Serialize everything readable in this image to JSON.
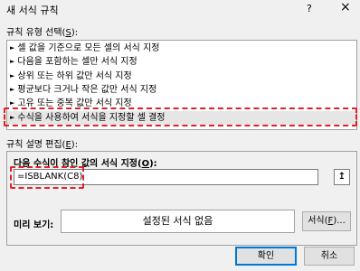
{
  "window": {
    "title": "새 서식 규칙",
    "help": "?",
    "close": "×"
  },
  "rule_type": {
    "label_prefix": "규칙 유형 선택(",
    "label_key": "S",
    "label_suffix": "):",
    "items": [
      "셀 값을 기준으로 모든 셀의 서식 지정",
      "다음을 포함하는 셀만 서식 지정",
      "상위 또는 하위 값만 서식 지정",
      "평균보다 크거나 작은 값만 서식 지정",
      "고유 또는 중복 값만 서식 지정",
      "수식을 사용하여 서식을 지정할 셀 결정"
    ],
    "selected_index": 5
  },
  "rule_desc": {
    "label_prefix": "규칙 설명 편집(",
    "label_key": "E",
    "label_suffix": "):",
    "formula_label_prefix": "다음 수식이 참인 값의 서식 지정(",
    "formula_label_key": "O",
    "formula_label_suffix": "):",
    "formula_value": "=ISBLANK(C8)",
    "collapse_icon": "↥"
  },
  "preview": {
    "label": "미리 보기:",
    "text": "설정된 서식 없음",
    "format_button_prefix": "서식(",
    "format_button_key": "F",
    "format_button_suffix": ")..."
  },
  "buttons": {
    "ok": "확인",
    "cancel": "취소"
  },
  "colors": {
    "highlight": "#e0202a",
    "selection": "#e6e6e6",
    "primary_border": "#0078d7"
  }
}
